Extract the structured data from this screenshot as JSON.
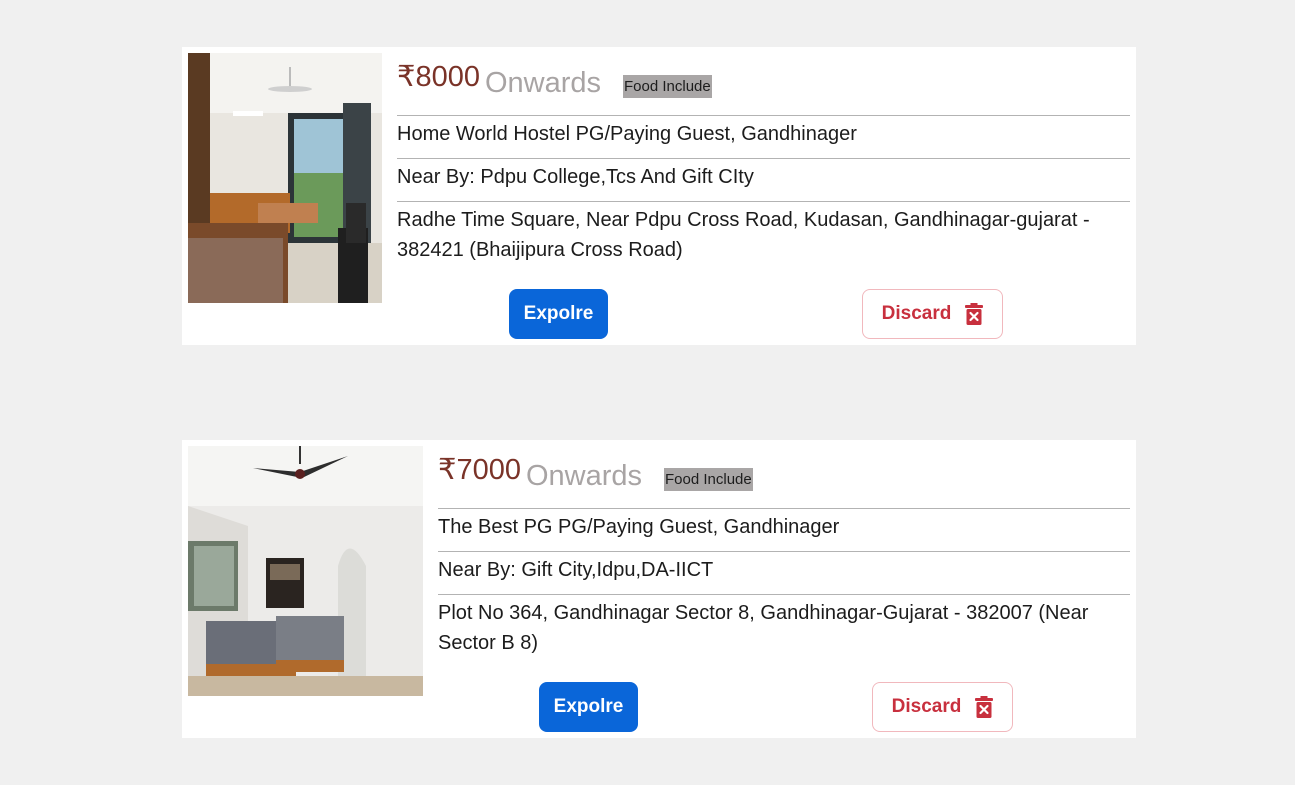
{
  "colors": {
    "page_background": "#f0f0f0",
    "price": "#7a3328",
    "explore_button": "#0a66d9",
    "discard_text": "#c8303e"
  },
  "listings": [
    {
      "price": "₹8000",
      "onwards": "Onwards",
      "food_badge": "Food Include",
      "name": "Home World Hostel PG/Paying Guest, Gandhinager",
      "near_by": "Near By: Pdpu College,Tcs And Gift CIty",
      "address": "Radhe Time Square, Near Pdpu Cross Road, Kudasan, Gandhinagar-gujarat - 382421 (Bhaijipura Cross Road)",
      "explore_label": "Expolre",
      "discard_label": "Discard",
      "discard_icon": "trash-x-icon"
    },
    {
      "price": "₹7000",
      "onwards": "Onwards",
      "food_badge": "Food Include",
      "name": "The Best PG PG/Paying Guest, Gandhinager",
      "near_by": "Near By: Gift City,Idpu,DA-IICT",
      "address": "Plot No 364, Gandhinagar Sector 8, Gandhinagar-Gujarat - 382007 (Near Sector B 8)",
      "explore_label": "Expolre",
      "discard_label": "Discard",
      "discard_icon": "trash-x-icon"
    }
  ]
}
